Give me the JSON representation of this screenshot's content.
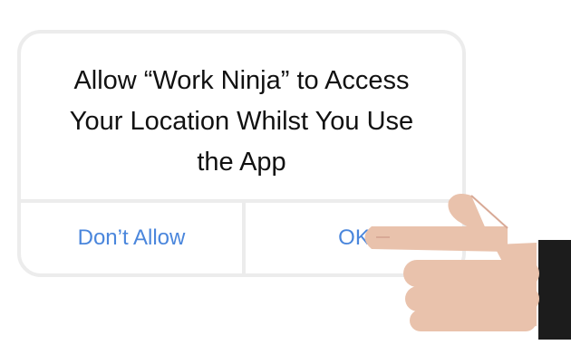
{
  "dialog": {
    "message_lines": [
      "Allow “Work Ninja” to Access",
      "Your Location Whilst You Use",
      "the App"
    ],
    "deny_label": "Don’t Allow",
    "allow_label": "OK"
  },
  "colors": {
    "button_text": "#4a86dc",
    "border": "#ececec",
    "skin": "#e9c2ac",
    "sleeve": "#1c1c1c"
  },
  "icons": {
    "pointer": "pointing-hand-icon"
  }
}
